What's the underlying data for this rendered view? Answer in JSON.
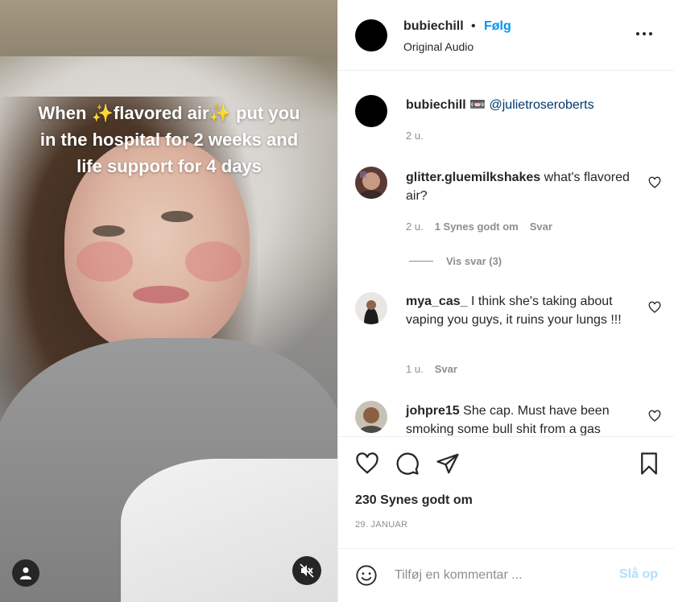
{
  "media": {
    "caption_text": "When ✨flavored air✨ put you in the hospital for 2 weeks and life support for 4 days"
  },
  "header": {
    "username": "bubiechill",
    "dot": "•",
    "follow_label": "Følg",
    "audio": "Original Audio"
  },
  "caption": {
    "username": "bubiechill",
    "emoji": "📼",
    "mention": "@julietroseroberts",
    "time": "2 u."
  },
  "comments": [
    {
      "username": "glitter.gluemilkshakes",
      "text": "what's flavored air?",
      "time": "2 u.",
      "likes": "1 Synes godt om",
      "reply": "Svar",
      "view_replies": "Vis svar (3)"
    },
    {
      "username": "mya_cas_",
      "text": "I think she's taking about vaping you guys, it ruins your lungs !!!",
      "time": "1 u.",
      "reply": "Svar"
    },
    {
      "username": "johpre15",
      "text": "She cap. Must have been smoking some bull shit from a gas"
    }
  ],
  "actions": {
    "likes": "230 Synes godt om",
    "date": "29. JANUAR"
  },
  "add_comment": {
    "placeholder": "Tilføj en kommentar ...",
    "post_label": "Slå op"
  },
  "colors": {
    "accent": "#0095f6",
    "post_disabled": "#b2dffc",
    "muted": "#8e8e8e",
    "text": "#262626"
  },
  "icons": [
    "user-icon",
    "mute-icon",
    "more-icon",
    "heart-icon",
    "comment-icon",
    "share-icon",
    "bookmark-icon",
    "emoji-icon"
  ]
}
